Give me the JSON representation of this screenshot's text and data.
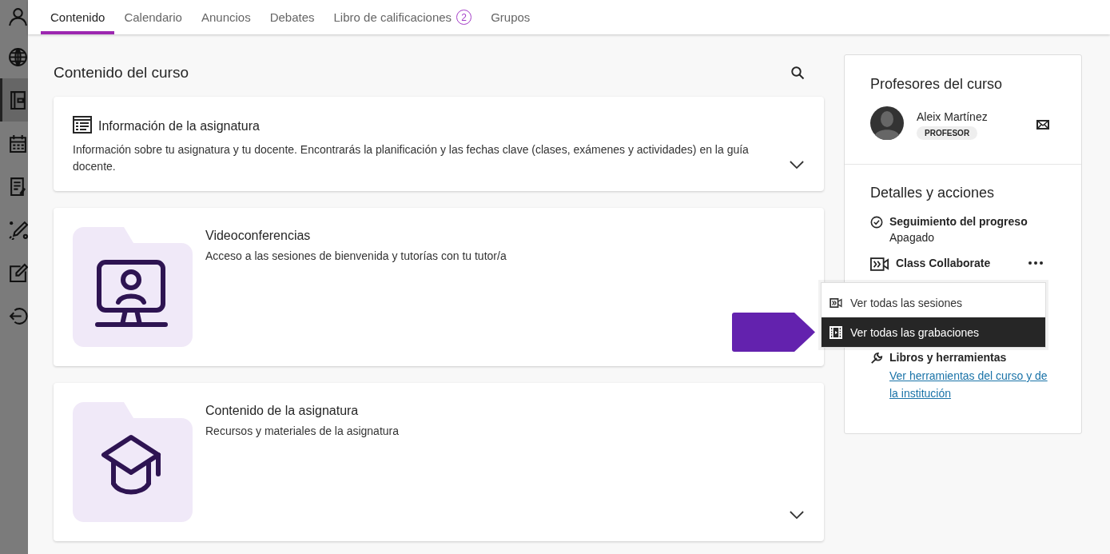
{
  "rail": [
    {
      "kind": "person",
      "selected": false
    },
    {
      "kind": "globe",
      "selected": false
    },
    {
      "kind": "course",
      "selected": true
    },
    {
      "kind": "calendar",
      "selected": false
    },
    {
      "kind": "grades",
      "selected": false
    },
    {
      "kind": "tools",
      "selected": false
    },
    {
      "kind": "edit",
      "selected": false
    },
    {
      "kind": "logout",
      "selected": false
    }
  ],
  "tabs": [
    {
      "label": "Contenido",
      "selected": true
    },
    {
      "label": "Calendario",
      "selected": false
    },
    {
      "label": "Anuncios",
      "selected": false
    },
    {
      "label": "Debates",
      "selected": false
    },
    {
      "label": "Libro de calificaciones",
      "selected": false,
      "badge": "2"
    },
    {
      "label": "Grupos",
      "selected": false
    }
  ],
  "content": {
    "title": "Contenido del curso",
    "items": [
      {
        "kind": "document",
        "title": "Información de la asignatura",
        "description": "Información sobre tu asignatura y tu docente. Encontrarás la planificación y las fechas clave (clases, exámenes y actividades) en la guía docente.",
        "expandable": true
      },
      {
        "kind": "folder",
        "title": "Videoconferencias",
        "description": "Acceso a las sesiones de bienvenida y tutorías con tu tutor/a",
        "expandable": false
      },
      {
        "kind": "folder",
        "title": "Contenido de la asignatura",
        "description": "Recursos y materiales de la asignatura",
        "expandable": true
      }
    ]
  },
  "teachers": {
    "title": "Profesores del curso",
    "people": [
      {
        "name": "Aleix Martínez",
        "role": "PROFESOR"
      }
    ]
  },
  "details": {
    "title": "Detalles y acciones",
    "items": [
      {
        "kind": "progress",
        "label": "Seguimiento del progreso",
        "value": "Apagado"
      },
      {
        "kind": "collaborate",
        "label": "Class Collaborate"
      },
      {
        "kind": "tools",
        "label": "Libros y herramientas",
        "link": "Ver herramientas del curso y de la institución"
      }
    ]
  },
  "menu": [
    {
      "kind": "sessions",
      "label": "Ver todas las sesiones",
      "selected": false
    },
    {
      "kind": "recordings",
      "label": "Ver todas las grabaciones",
      "selected": true
    }
  ]
}
